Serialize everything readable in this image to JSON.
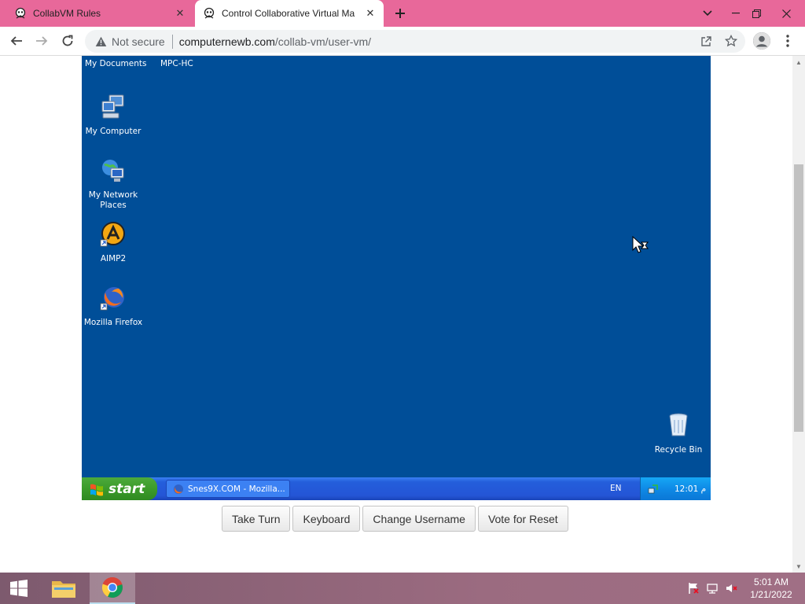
{
  "browser": {
    "tabs": [
      {
        "title": "CollabVM Rules",
        "active": false
      },
      {
        "title": "Control Collaborative Virtual Ma",
        "active": true
      }
    ],
    "address": {
      "security_label": "Not secure",
      "host": "computernewb.com",
      "path": "/collab-vm/user-vm/"
    }
  },
  "vm": {
    "desktop_top_labels": [
      "My Documents",
      "MPC-HC"
    ],
    "desktop_icons": [
      {
        "label": "My Computer",
        "icon": "my-computer-icon"
      },
      {
        "label": "My Network Places",
        "icon": "network-places-icon"
      },
      {
        "label": "AIMP2",
        "icon": "aimp2-icon"
      },
      {
        "label": "Mozilla Firefox",
        "icon": "firefox-icon"
      },
      {
        "label": "Recycle Bin",
        "icon": "recycle-bin-icon"
      }
    ],
    "taskbar": {
      "start_label": "start",
      "task_button": "Snes9X.COM - Mozilla...",
      "language": "EN",
      "clock": "12:01 م"
    },
    "background_color": "#004e98"
  },
  "controls": {
    "take_turn": "Take Turn",
    "keyboard": "Keyboard",
    "change_username": "Change Username",
    "vote_reset": "Vote for Reset"
  },
  "windows_taskbar": {
    "time": "5:01 AM",
    "date": "1/21/2022"
  }
}
